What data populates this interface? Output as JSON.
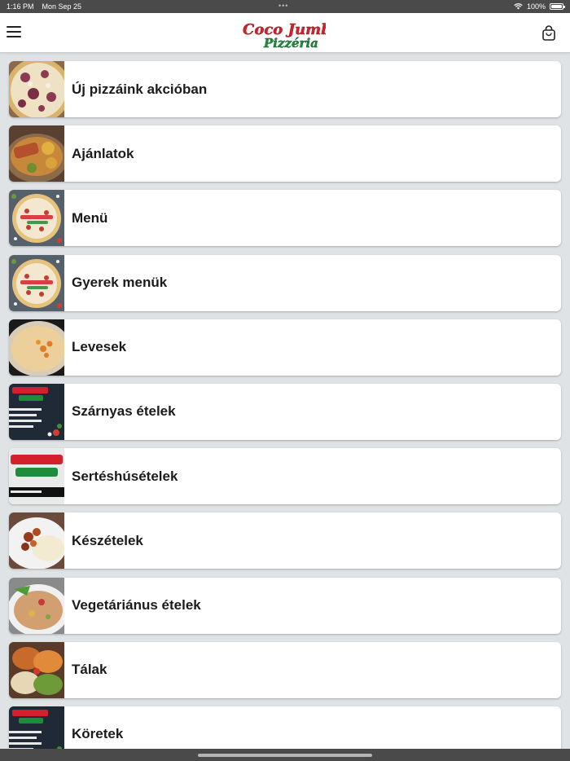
{
  "status_bar": {
    "time": "1:16 PM",
    "date": "Mon Sep 25",
    "battery": "100%"
  },
  "header": {
    "logo_line1": "Coco Jumbo",
    "logo_line2": "Pizzéria",
    "menu_icon": "hamburger-menu-icon",
    "cart_icon": "shopping-bag-icon"
  },
  "categories": [
    {
      "label": "Új pizzáink akcióban",
      "thumb": "pizza"
    },
    {
      "label": "Ajánlatok",
      "thumb": "platter"
    },
    {
      "label": "Menü",
      "thumb": "logo-pizza"
    },
    {
      "label": "Gyerek menük",
      "thumb": "logo-pizza"
    },
    {
      "label": "Levesek",
      "thumb": "soup"
    },
    {
      "label": "Szárnyas ételek",
      "thumb": "promo"
    },
    {
      "label": "Sertéshúsételek",
      "thumb": "promo2"
    },
    {
      "label": "Készételek",
      "thumb": "stew"
    },
    {
      "label": "Vegetáriánus ételek",
      "thumb": "veggie"
    },
    {
      "label": "Tálak",
      "thumb": "platter2"
    },
    {
      "label": "Köretek",
      "thumb": "promo"
    }
  ],
  "colors": {
    "background": "#dfe3e5",
    "brand_red": "#d3202b",
    "brand_green": "#1e8c3a"
  }
}
